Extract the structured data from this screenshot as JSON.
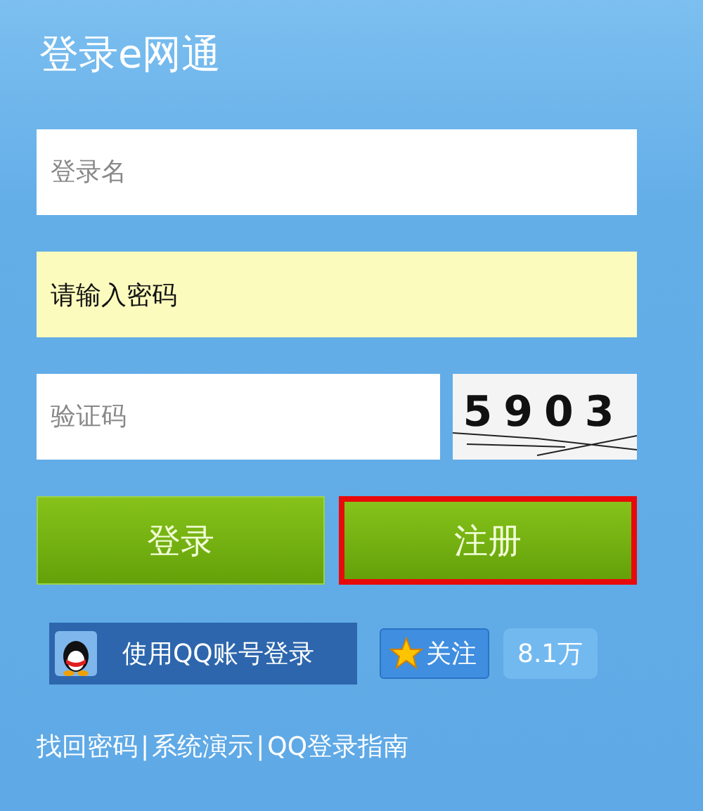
{
  "title": "登录e网通",
  "fields": [
    {
      "kind": "text",
      "placeholder": "登录名"
    },
    {
      "kind": "password",
      "value": "请输入密码"
    }
  ],
  "captcha": {
    "placeholder": "验证码",
    "code": "5903"
  },
  "buttons": [
    {
      "label": "登录",
      "highlighted": false
    },
    {
      "label": "注册",
      "highlighted": true
    }
  ],
  "qq_login": {
    "label": "使用QQ账号登录"
  },
  "follow": {
    "label": "关注",
    "count": "8.1万"
  },
  "links": [
    {
      "label": "找回密码"
    },
    {
      "label": "系统演示"
    },
    {
      "label": "QQ登录指南"
    }
  ],
  "separator": "|"
}
